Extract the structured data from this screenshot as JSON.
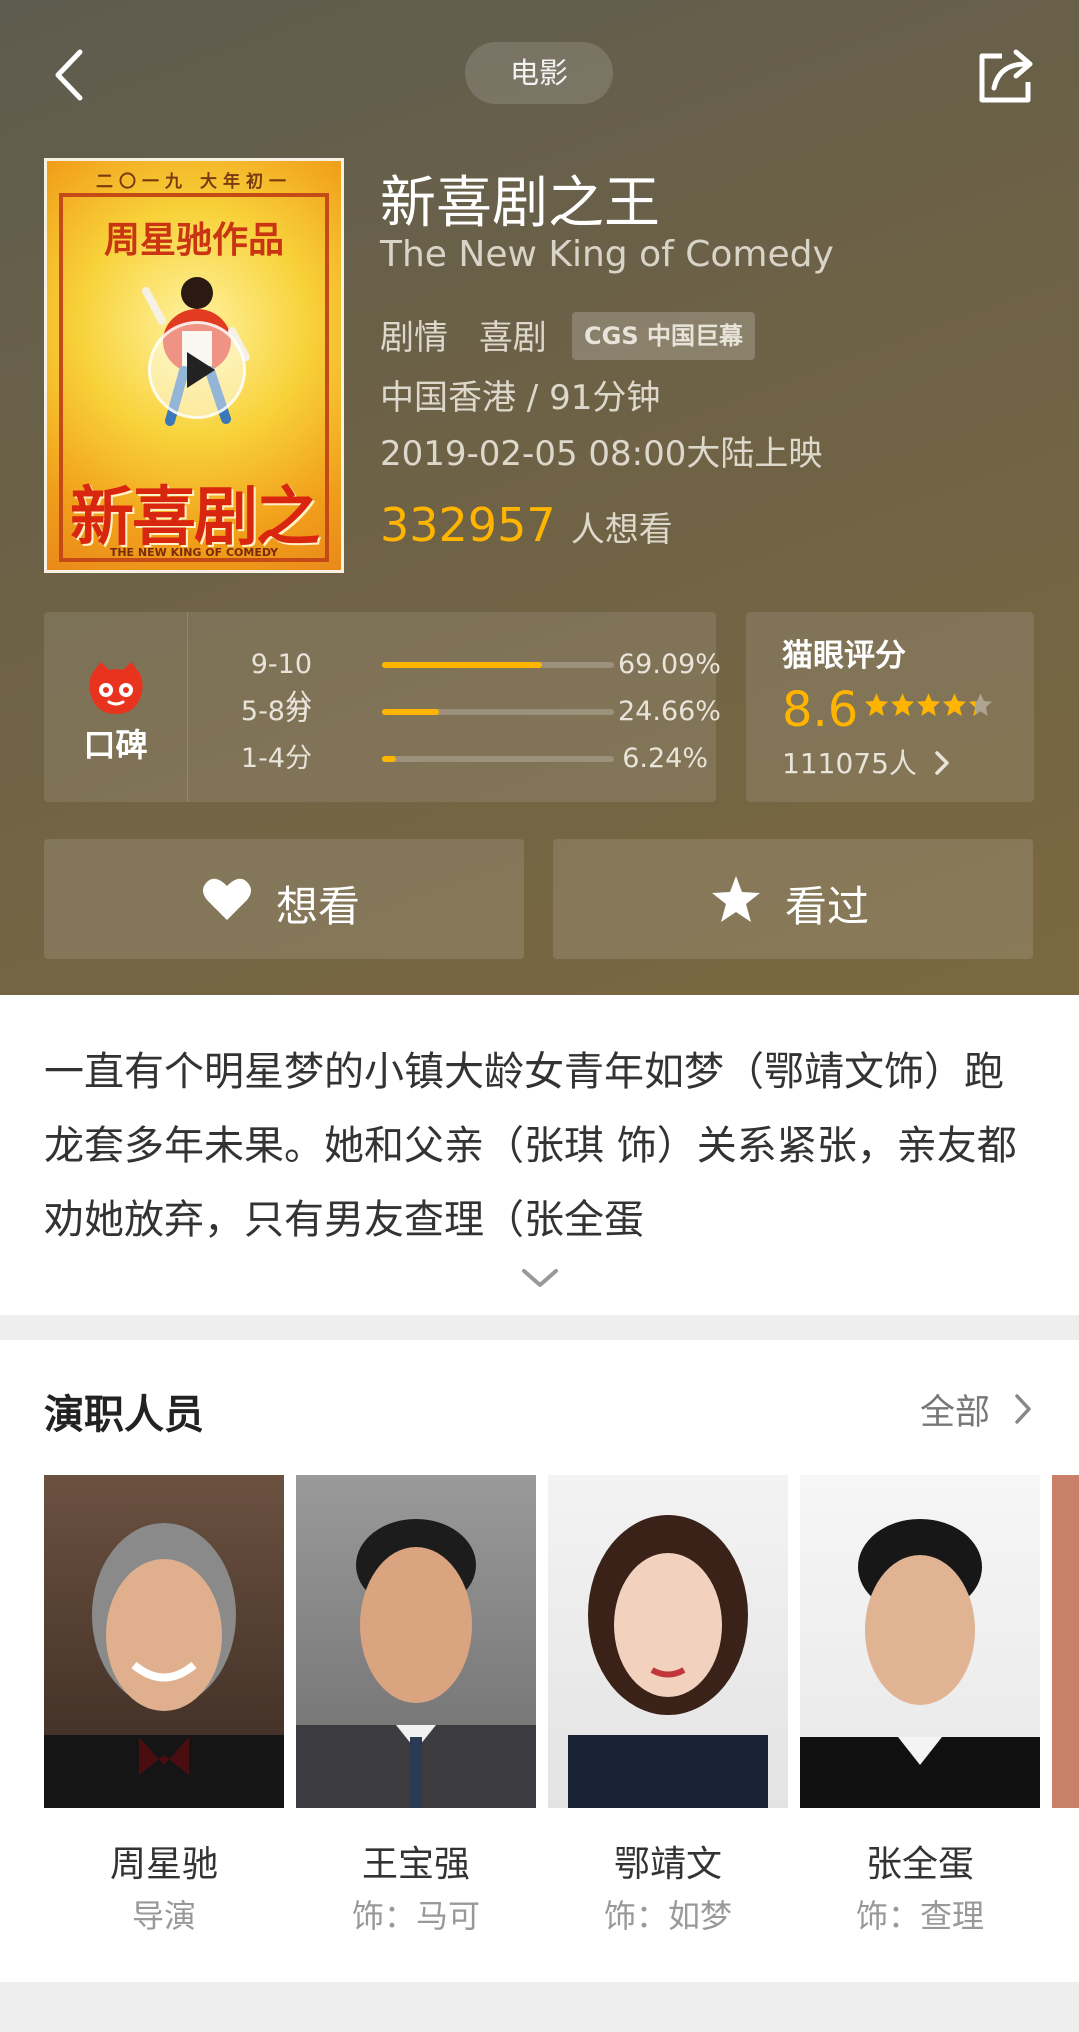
{
  "header": {
    "category": "电影"
  },
  "movie": {
    "title": "新喜剧之王",
    "en_title": "The New King of Comedy",
    "genres": [
      "剧情",
      "喜剧"
    ],
    "badge": "CGS 中国巨幕",
    "region_duration": "中国香港 / 91分钟",
    "release": "2019-02-05 08:00大陆上映",
    "wish_count": "332957",
    "wish_label": "人想看",
    "poster": {
      "top_text": "二〇一九 大年初一",
      "director_text": "周星驰作品",
      "title_text": "新喜剧之王",
      "sub_text": "THE NEW KING OF COMEDY"
    }
  },
  "word_of_mouth": {
    "label": "口碑",
    "rows": [
      {
        "label": "9-10分",
        "percent": "69.09%",
        "fraction": 0.6909
      },
      {
        "label": "5-8分",
        "percent": "24.66%",
        "fraction": 0.2466
      },
      {
        "label": "1-4分",
        "percent": "6.24%",
        "fraction": 0.0624
      }
    ]
  },
  "score": {
    "label": "猫眼评分",
    "value": "8.6",
    "stars": 4.3,
    "people": "111075人"
  },
  "actions": {
    "want": "想看",
    "seen": "看过"
  },
  "synopsis": {
    "text": "一直有个明星梦的小镇大龄女青年如梦（鄂靖文饰）跑龙套多年未果。她和父亲（张琪 饰）关系紧张，亲友都劝她放弃，只有男友查理（张全蛋"
  },
  "cast": {
    "heading": "演职人员",
    "all": "全部",
    "members": [
      {
        "name": "周星驰",
        "role": "导演"
      },
      {
        "name": "王宝强",
        "role": "饰：马可"
      },
      {
        "name": "鄂靖文",
        "role": "饰：如梦"
      },
      {
        "name": "张全蛋",
        "role": "饰：查理"
      }
    ]
  },
  "colors": {
    "accent": "#ffb400",
    "hero_bg": "#6e6246"
  }
}
